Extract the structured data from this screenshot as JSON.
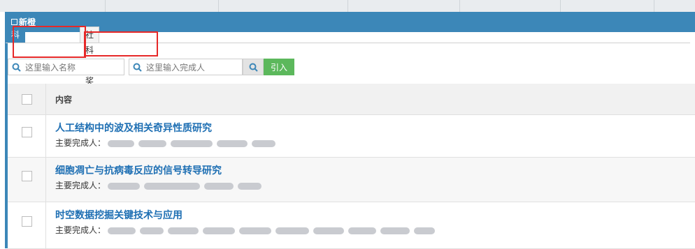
{
  "panel": {
    "title": "新橙"
  },
  "tabs": [
    {
      "label": "科发院奖励库",
      "active": true
    },
    {
      "label": "社科院奖励库",
      "active": false
    }
  ],
  "search": {
    "name_placeholder": "这里输入名称",
    "completer_placeholder": "这里输入完成人",
    "import_label": "引入"
  },
  "table": {
    "header": {
      "content_label": "内容"
    },
    "rows": [
      {
        "title": "人工结构中的波及相关奇异性质研究",
        "completers_label": "主要完成人："
      },
      {
        "title": "细胞凋亡与抗病毒反应的信号转导研究",
        "completers_label": "主要完成人："
      },
      {
        "title": "时空数据挖掘关键技术与应用",
        "completers_label": "主要完成人："
      }
    ]
  },
  "colors": {
    "header_bg": "#3c87b8",
    "link": "#1e6fb3",
    "import_button": "#5cb85c",
    "highlight_box": "#e62828"
  }
}
